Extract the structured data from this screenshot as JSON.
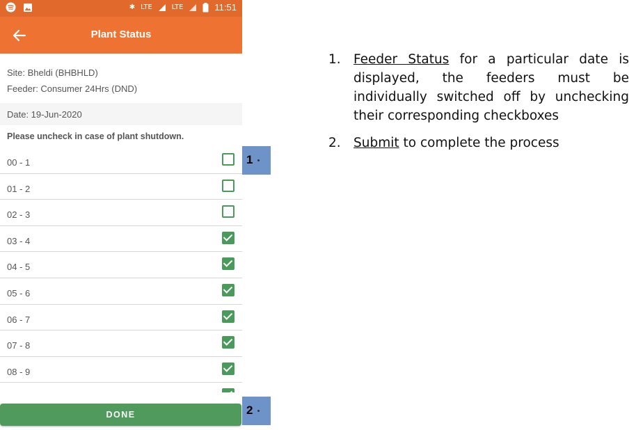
{
  "status_bar": {
    "time": "11:51",
    "signal_text": "LTE",
    "signal_text_2": "LTE"
  },
  "app_bar": {
    "title": "Plant Status"
  },
  "info": {
    "site": "Site: Bheldi (BHBHLD)",
    "feeder": "Feeder: Consumer 24Hrs (DND)"
  },
  "date": "Date: 19-Jun-2020",
  "instruction": "Please uncheck in case of plant shutdown.",
  "hours": [
    {
      "label": "00 - 1",
      "checked": false
    },
    {
      "label": "01 - 2",
      "checked": false
    },
    {
      "label": "02 - 3",
      "checked": false
    },
    {
      "label": "03 - 4",
      "checked": true
    },
    {
      "label": "04 - 5",
      "checked": true
    },
    {
      "label": "05 - 6",
      "checked": true
    },
    {
      "label": "06 - 7",
      "checked": true
    },
    {
      "label": "07 - 8",
      "checked": true
    },
    {
      "label": "08 - 9",
      "checked": true
    },
    {
      "label": "",
      "checked": true
    }
  ],
  "done_label": "DONE",
  "markers": {
    "m1": "1",
    "m2": "2"
  },
  "steps": [
    {
      "num": "1.",
      "link": "Feeder Status",
      "rest": " for a particular date is displayed, the feeders must be individually switched off by unchecking their corresponding checkboxes"
    },
    {
      "num": "2.",
      "link": "Submit",
      "rest": " to complete the process"
    }
  ],
  "colors": {
    "app_bar": "#ee7333",
    "status_bar": "#e0692b",
    "checkbox": "#4a9a5b",
    "done_button": "#4f9a5c",
    "marker": "#6d93c9"
  }
}
